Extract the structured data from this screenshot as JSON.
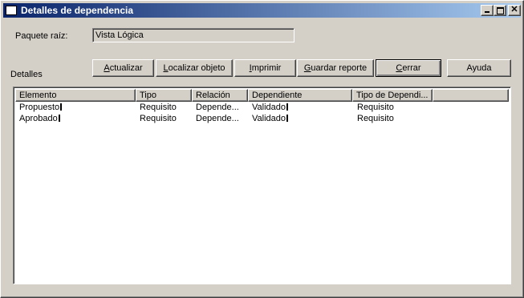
{
  "window": {
    "title": "Detalles de dependencia"
  },
  "root_package": {
    "label": "Paquete raíz:",
    "value": "Vista Lógica"
  },
  "details_label": "Detalles",
  "buttons": [
    {
      "label": "Actualizar",
      "key": "A",
      "rest": "ctualizar"
    },
    {
      "label": "Localizar objeto",
      "key": "L",
      "rest": "ocalizar objeto"
    },
    {
      "label": "Imprimir",
      "key": "I",
      "rest": "mprimir"
    },
    {
      "label": "Guardar reporte",
      "key": "G",
      "rest": "uardar reporte"
    },
    {
      "label": "Cerrar",
      "key": "C",
      "rest": "errar"
    },
    {
      "label": "Ayuda",
      "key": "",
      "rest": "Ayuda"
    }
  ],
  "table": {
    "columns": [
      "Elemento",
      "Tipo",
      "Relación",
      "Dependiente",
      "Tipo de Dependi..."
    ],
    "rows": [
      [
        "Propuesto",
        "Requisito",
        "Depende...",
        "Validado",
        "Requisito"
      ],
      [
        "Aprobado",
        "Requisito",
        "Depende...",
        "Validado",
        "Requisito"
      ]
    ]
  }
}
